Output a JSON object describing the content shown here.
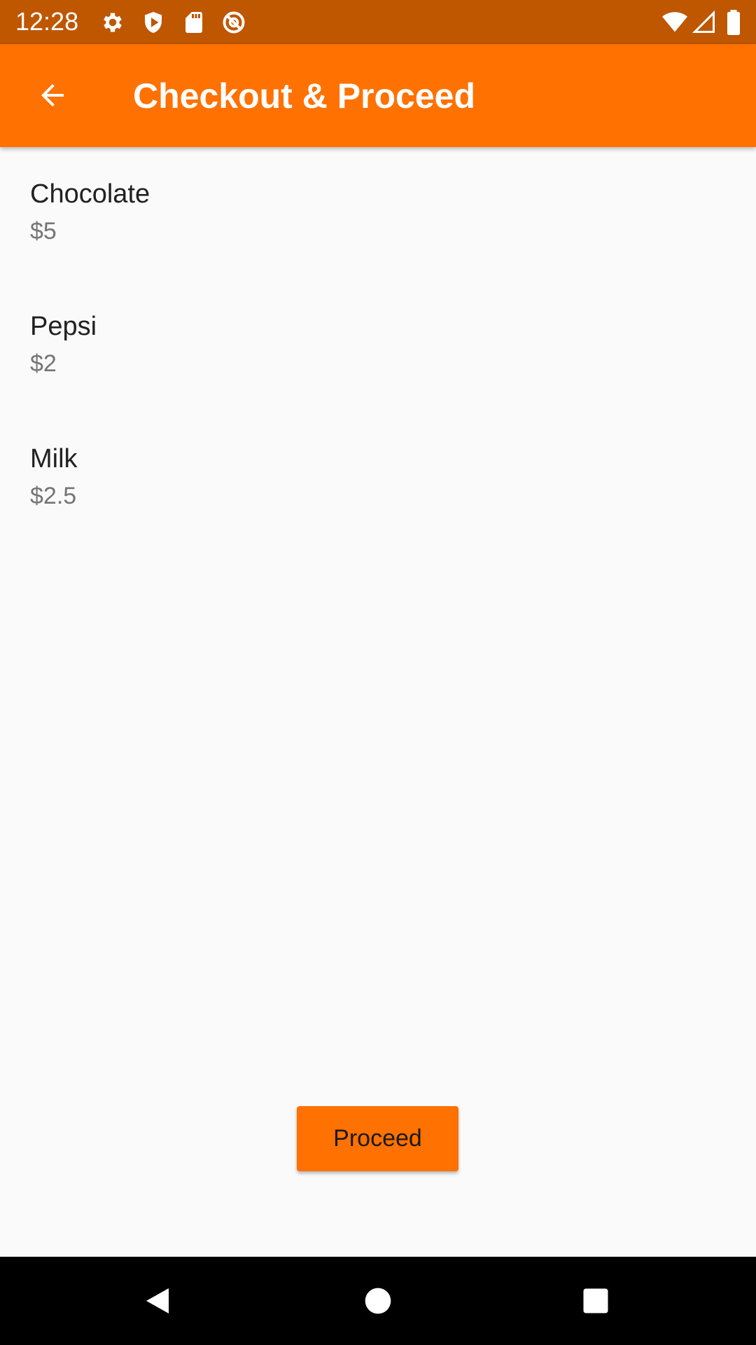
{
  "status_bar": {
    "time": "12:28",
    "left_icons": [
      "settings-icon",
      "shield-play-icon",
      "sd-card-icon",
      "sync-disabled-icon"
    ],
    "right_icons": [
      "wifi-icon",
      "cell-signal-icon",
      "battery-icon"
    ]
  },
  "app_bar": {
    "title": "Checkout & Proceed",
    "back_icon": "arrow-back-icon"
  },
  "items": [
    {
      "name": "Chocolate",
      "price": "$5"
    },
    {
      "name": "Pepsi",
      "price": "$2"
    },
    {
      "name": "Milk",
      "price": "$2.5"
    }
  ],
  "actions": {
    "proceed_label": "Proceed"
  },
  "nav_bar": {
    "buttons": [
      "back-triangle-icon",
      "home-circle-icon",
      "recents-square-icon"
    ]
  },
  "colors": {
    "status_bar": "#bf5600",
    "accent": "#ff7100",
    "background": "#fafafa",
    "primary_text": "#212121",
    "secondary_text": "#757575"
  }
}
